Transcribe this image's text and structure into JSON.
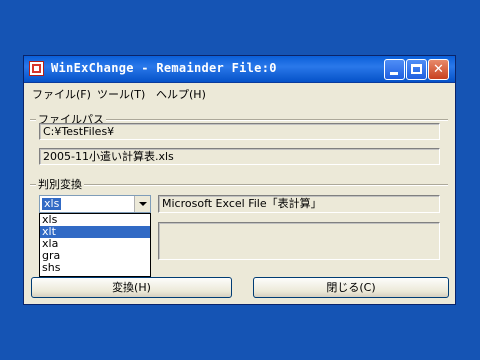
{
  "window": {
    "title": "WinExChange - Remainder File:0"
  },
  "menu": {
    "items": [
      "ファイル(F)",
      "ツール(T)",
      "ヘルプ(H)"
    ]
  },
  "file_path_group": {
    "label": "ファイルパス",
    "folder": "C:¥TestFiles¥",
    "filename": "2005-11小遣い計算表.xls"
  },
  "convert_group": {
    "label": "判別変換",
    "selected_ext": "xls",
    "description": "Microsoft Excel File「表計算」",
    "options": [
      "xls",
      "xlt",
      "xla",
      "gra",
      "shs"
    ],
    "highlighted_option": "xlt"
  },
  "buttons": {
    "convert": "変換(H)",
    "close": "閉じる(C)"
  }
}
